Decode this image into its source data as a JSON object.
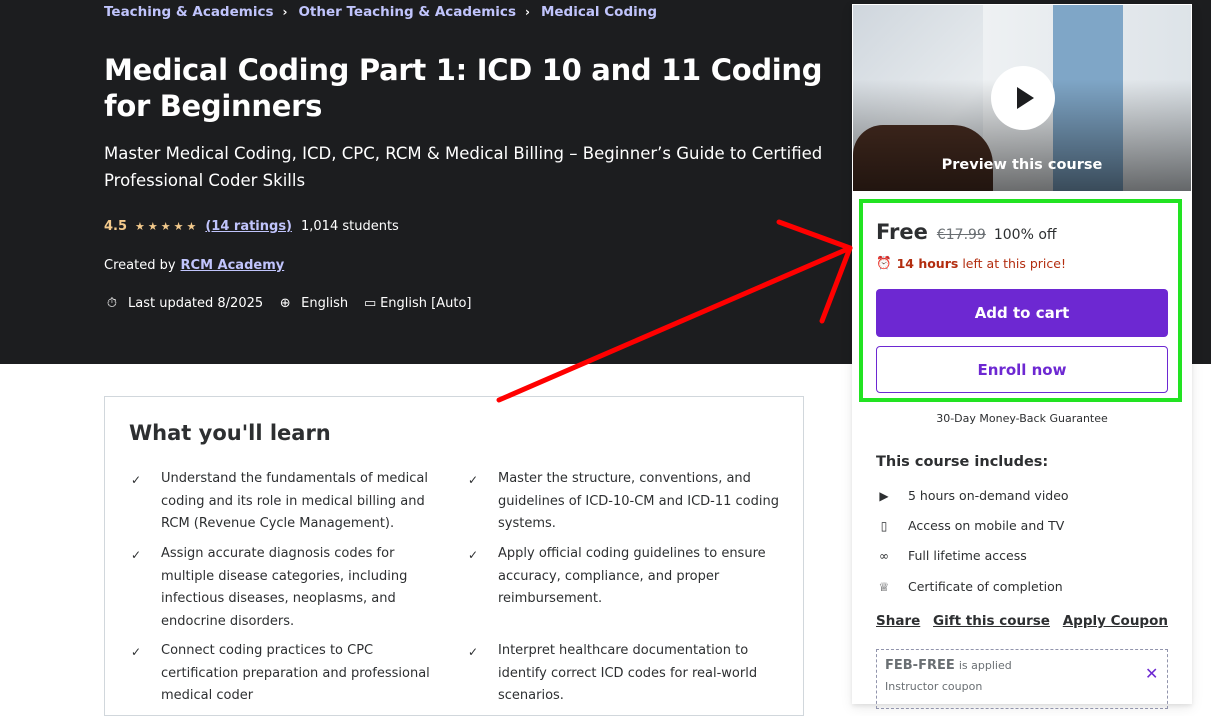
{
  "breadcrumb": [
    "Teaching & Academics",
    "Other Teaching & Academics",
    "Medical Coding"
  ],
  "course": {
    "title": "Medical Coding Part 1: ICD 10 and 11 Coding for Beginners",
    "subtitle": "Master Medical Coding, ICD, CPC, RCM & Medical Billing – Beginner’s Guide to Certified Professional Coder Skills",
    "rating": "4.5",
    "stars": "★★★★★",
    "ratings_link": "(14 ratings)",
    "students": "1,014 students",
    "created_label": "Created by",
    "instructor": "RCM Academy",
    "last_updated": "Last updated 8/2025",
    "language": "English",
    "captions": "English [Auto]"
  },
  "learn": {
    "title": "What you'll learn",
    "items": [
      "Understand the fundamentals of medical coding and its role in medical billing and RCM (Revenue Cycle Management).",
      "Master the structure, conventions, and guidelines of ICD-10-CM and ICD-11 coding systems.",
      "Assign accurate diagnosis codes for multiple disease categories, including infectious diseases, neoplasms, and endocrine disorders.",
      "Apply official coding guidelines to ensure accuracy, compliance, and proper reimbursement.",
      "Connect coding practices to CPC certification preparation and professional medical coder",
      "Interpret healthcare documentation to identify correct ICD codes for real-world scenarios."
    ]
  },
  "sidebar": {
    "preview_label": "Preview this course",
    "price": "Free",
    "original_price": "€17.99",
    "discount": "100% off",
    "timer_hours": "14 hours",
    "timer_text": "left at this price!",
    "add_to_cart": "Add to cart",
    "enroll_now": "Enroll now",
    "guarantee": "30-Day Money-Back Guarantee",
    "includes_title": "This course includes:",
    "includes": [
      {
        "icon": "video-icon",
        "label": "5 hours on-demand video"
      },
      {
        "icon": "mobile-icon",
        "label": "Access on mobile and TV"
      },
      {
        "icon": "infinity-icon",
        "label": "Full lifetime access"
      },
      {
        "icon": "trophy-icon",
        "label": "Certificate of completion"
      }
    ],
    "share": "Share",
    "gift": "Gift this course",
    "apply_coupon": "Apply Coupon",
    "coupon_code": "FEB-FREE",
    "coupon_applied": "is applied",
    "coupon_sub": "Instructor coupon"
  },
  "colors": {
    "hero_bg": "#1c1d1f",
    "link_purple_light": "#c0c4fc",
    "star": "#f3ca8c",
    "primary": "#6d28d2",
    "timer_red": "#b32d0f",
    "annotation_green": "#22e322",
    "annotation_red": "#ff0000"
  }
}
